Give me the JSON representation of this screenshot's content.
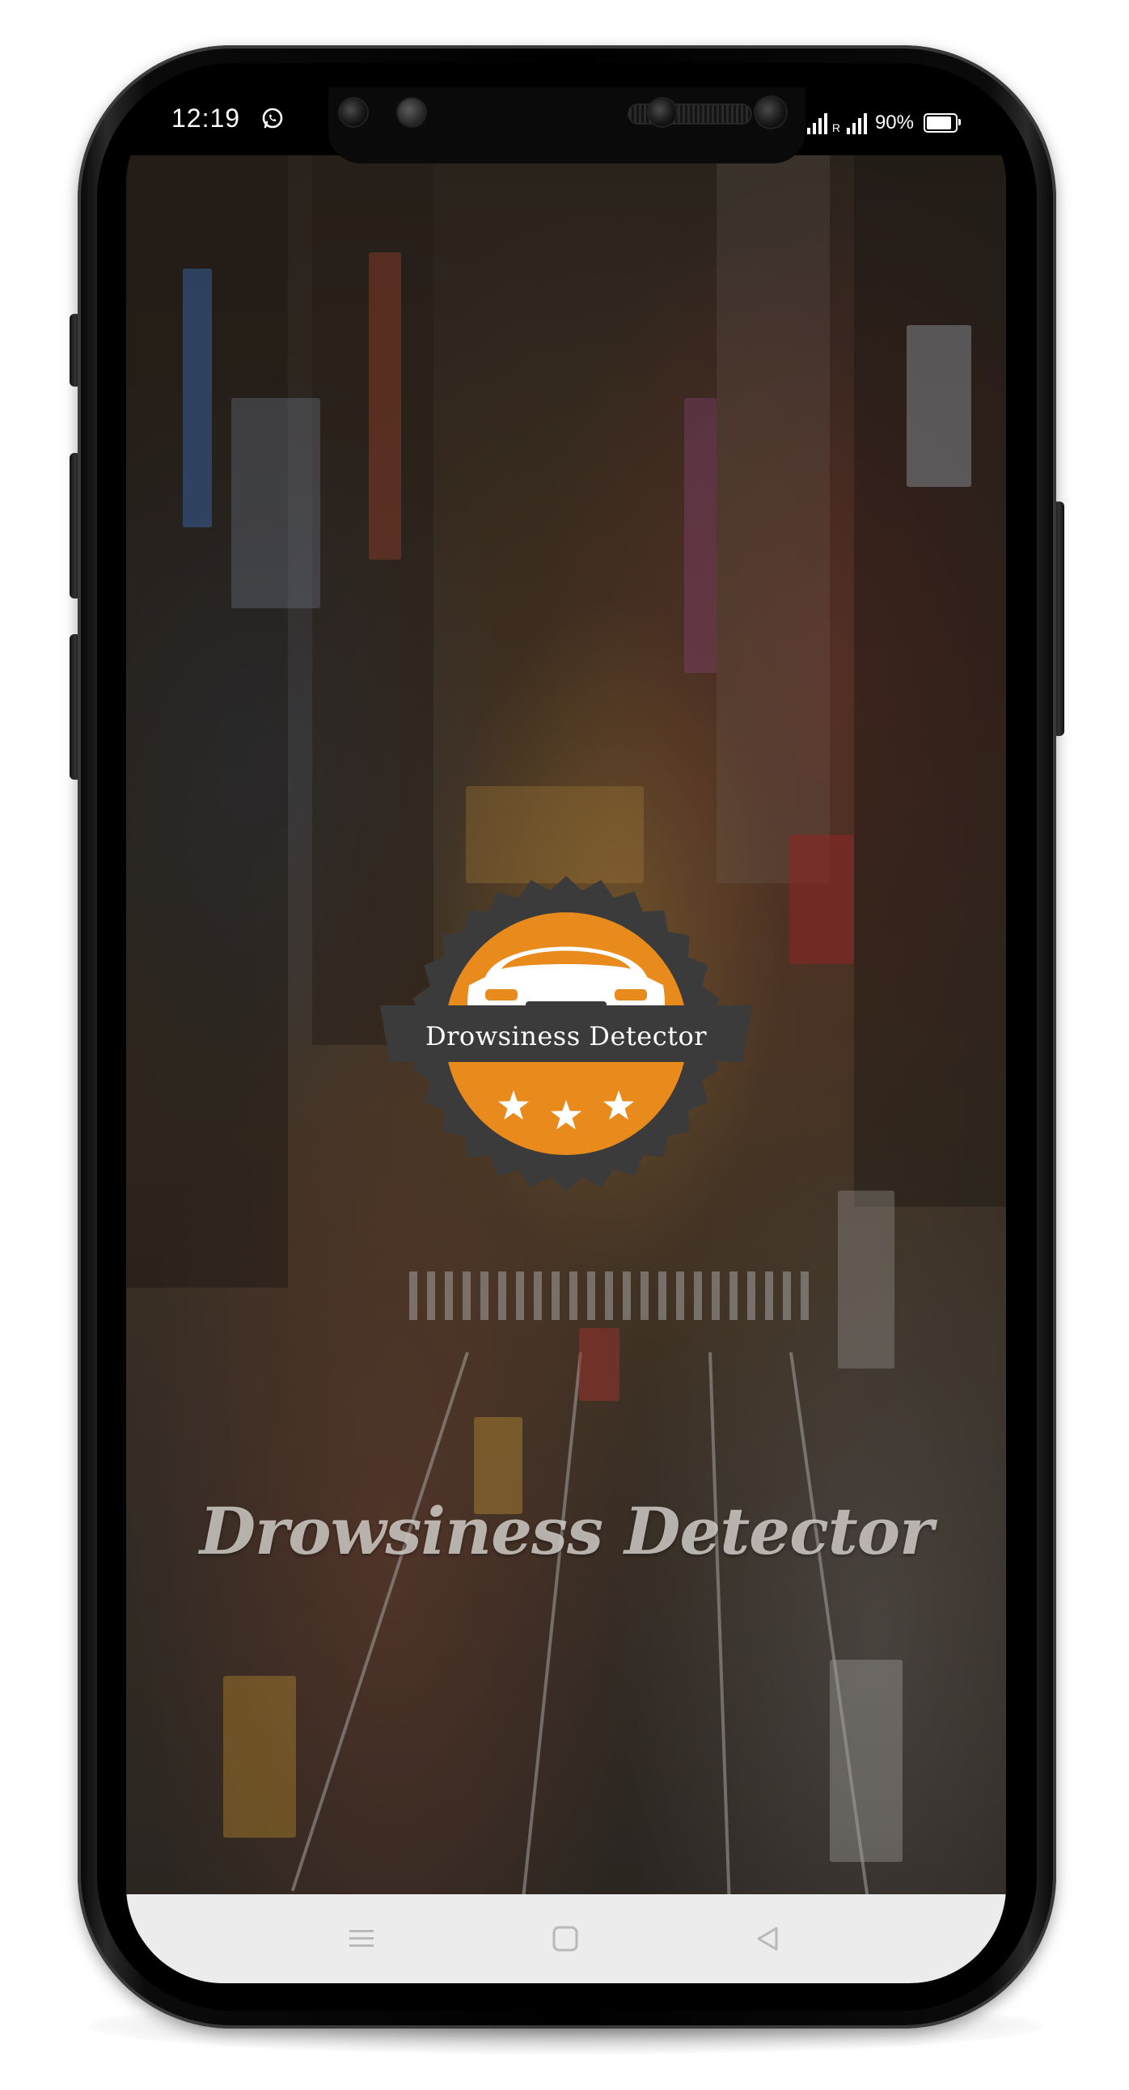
{
  "status_bar": {
    "time": "12:19",
    "notification_icon": "whatsapp-icon",
    "signal_icon": "signal-icon",
    "roaming_label": "R",
    "battery_percent": "90%",
    "battery_level": 0.9,
    "battery_icon": "battery-icon"
  },
  "splash": {
    "logo_text": "Drowsiness Detector",
    "logo_icon": "car-icon",
    "logo_colors": {
      "badge_dark": "#3b3b3c",
      "badge_orange": "#e98a1c",
      "car_white": "#ffffff"
    },
    "star_count": 3,
    "app_name": "Drowsiness Detector"
  },
  "nav_bar": {
    "buttons": [
      {
        "name": "menu",
        "icon": "menu-icon"
      },
      {
        "name": "home",
        "icon": "square-icon"
      },
      {
        "name": "back",
        "icon": "back-triangle-icon"
      }
    ]
  }
}
